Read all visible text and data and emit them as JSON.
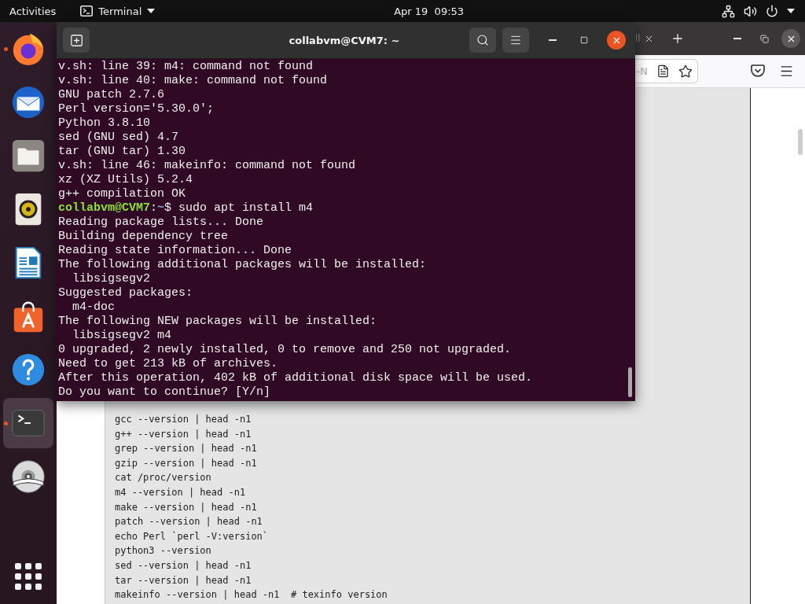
{
  "top_bar": {
    "activities": "Activities",
    "app_menu": "Terminal",
    "clock": "Apr 19  09:53"
  },
  "dock": {
    "apps": [
      {
        "kind": "browser",
        "running": true,
        "selected": false
      },
      {
        "kind": "mail",
        "running": false,
        "selected": false
      },
      {
        "kind": "files",
        "running": false,
        "selected": false
      },
      {
        "kind": "music",
        "running": false,
        "selected": false
      },
      {
        "kind": "writer",
        "running": false,
        "selected": false
      },
      {
        "kind": "software",
        "running": false,
        "selected": false
      },
      {
        "kind": "help",
        "running": false,
        "selected": false
      },
      {
        "kind": "terminal",
        "running": true,
        "selected": true
      },
      {
        "kind": "disc",
        "running": false,
        "selected": false
      }
    ]
  },
  "browser": {
    "tab": {
      "title": "ll"
    },
    "address_bar": {
      "value": "-N"
    },
    "code_lines": [
      "gcc --version | head -n1",
      "g++ --version | head -n1",
      "grep --version | head -n1",
      "gzip --version | head -n1",
      "cat /proc/version",
      "m4 --version | head -n1",
      "make --version | head -n1",
      "patch --version | head -n1",
      "echo Perl `perl -V:version`",
      "python3 --version",
      "sed --version | head -n1",
      "tar --version | head -n1",
      "makeinfo --version | head -n1  # texinfo version"
    ]
  },
  "terminal": {
    "title": "collabvm@CVM7: ~",
    "lines": [
      {
        "kind": "output",
        "text": "v.sh: line 39: m4: command not found"
      },
      {
        "kind": "output",
        "text": "v.sh: line 40: make: command not found"
      },
      {
        "kind": "output",
        "text": "GNU patch 2.7.6"
      },
      {
        "kind": "output",
        "text": "Perl version='5.30.0';"
      },
      {
        "kind": "output",
        "text": "Python 3.8.10"
      },
      {
        "kind": "output",
        "text": "sed (GNU sed) 4.7"
      },
      {
        "kind": "output",
        "text": "tar (GNU tar) 1.30"
      },
      {
        "kind": "output",
        "text": "v.sh: line 46: makeinfo: command not found"
      },
      {
        "kind": "output",
        "text": "xz (XZ Utils) 5.2.4"
      },
      {
        "kind": "output",
        "text": "g++ compilation OK"
      },
      {
        "kind": "prompt",
        "segments": [
          {
            "kind": "user",
            "text": "collabvm@CVM7"
          },
          {
            "kind": "plain",
            "text": ":"
          },
          {
            "kind": "path",
            "text": "~"
          },
          {
            "kind": "plain",
            "text": "$ sudo apt install m4"
          }
        ]
      },
      {
        "kind": "output",
        "text": "Reading package lists... Done"
      },
      {
        "kind": "output",
        "text": "Building dependency tree"
      },
      {
        "kind": "output",
        "text": "Reading state information... Done"
      },
      {
        "kind": "output",
        "text": "The following additional packages will be installed:"
      },
      {
        "kind": "output",
        "text": "  libsigsegv2"
      },
      {
        "kind": "output",
        "text": "Suggested packages:"
      },
      {
        "kind": "output",
        "text": "  m4-doc"
      },
      {
        "kind": "output",
        "text": "The following NEW packages will be installed:"
      },
      {
        "kind": "output",
        "text": "  libsigsegv2 m4"
      },
      {
        "kind": "output",
        "text": "0 upgraded, 2 newly installed, 0 to remove and 250 not upgraded."
      },
      {
        "kind": "output",
        "text": "Need to get 213 kB of archives."
      },
      {
        "kind": "output",
        "text": "After this operation, 402 kB of additional disk space will be used."
      },
      {
        "kind": "output",
        "text": "Do you want to continue? [Y/n]"
      }
    ]
  }
}
